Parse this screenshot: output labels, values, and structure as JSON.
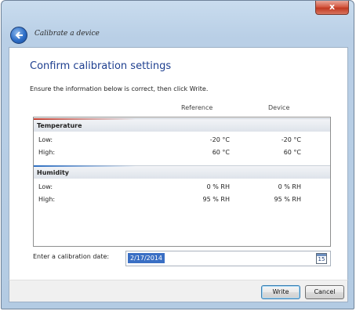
{
  "window": {
    "close_label": "x",
    "title": "Calibrate a device"
  },
  "page": {
    "heading": "Confirm calibration settings",
    "instruction": "Ensure the information below is correct, then click Write.",
    "columns": {
      "reference": "Reference",
      "device": "Device"
    }
  },
  "groups": [
    {
      "name": "Temperature",
      "accent": "#c0392b",
      "rows": [
        {
          "label": "Low:",
          "reference": "-20 °C",
          "device": "-20 °C"
        },
        {
          "label": "High:",
          "reference": "60 °C",
          "device": "60 °C"
        }
      ]
    },
    {
      "name": "Humidity",
      "accent": "#2e6fc2",
      "rows": [
        {
          "label": "Low:",
          "reference": "0 % RH",
          "device": "0 % RH"
        },
        {
          "label": "High:",
          "reference": "95 % RH",
          "device": "95 % RH"
        }
      ]
    }
  ],
  "date": {
    "label": "Enter a calibration date:",
    "value": "2/17/2014",
    "calendar_day": "15"
  },
  "buttons": {
    "write": "Write",
    "cancel": "Cancel"
  },
  "icons": {
    "back": "back-arrow-icon",
    "calendar": "calendar-icon",
    "close": "close-icon"
  }
}
